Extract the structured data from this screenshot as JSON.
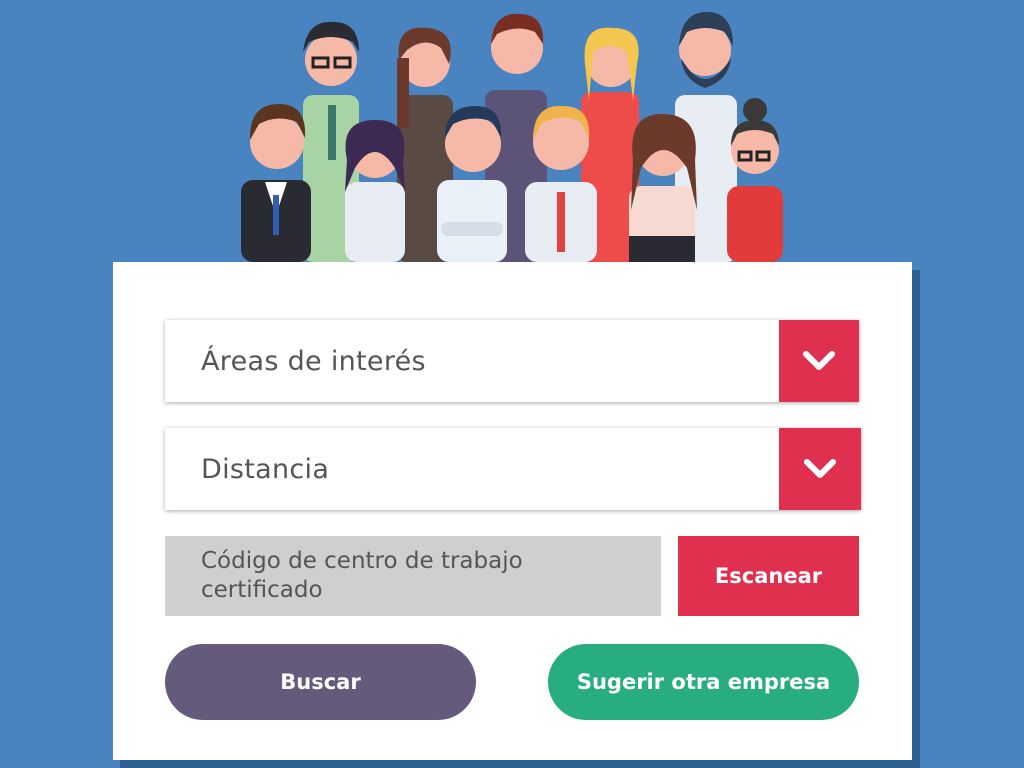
{
  "hero": {
    "icon": "team-of-people-illustration"
  },
  "form": {
    "areas_label": "Áreas de interés",
    "distance_label": "Distancia",
    "code_placeholder": "Código de centro de trabajo certificado",
    "scan_label": "Escanear",
    "search_label": "Buscar",
    "suggest_label": "Sugerir otra empresa"
  },
  "colors": {
    "background": "#4a84c0",
    "accent_red": "#e0304f",
    "search_purple": "#655a7c",
    "suggest_green": "#27ad7f",
    "field_gray": "#cfcfcf"
  }
}
